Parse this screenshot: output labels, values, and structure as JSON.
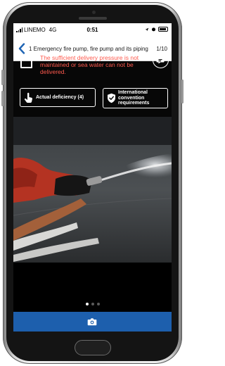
{
  "status_bar": {
    "carrier": "LINEMO",
    "network": "4G",
    "time": "0:51"
  },
  "nav": {
    "title": "1 Emergency fire pump, fire pump and its piping",
    "counter": "1/10"
  },
  "item": {
    "warning_text": "The sufficient delivery pressure is not maintained or sea water can not be delivered.",
    "checked": false
  },
  "buttons": {
    "actual_deficiency": "Actual deficiency (4)",
    "international_convention": "International convention requirements"
  },
  "pager": {
    "total": 3,
    "current": 1
  },
  "colors": {
    "accent_blue": "#1e64b4",
    "camera_bar": "#1d5fad",
    "warning_red": "#ff5a4e"
  },
  "icons": {
    "back": "chevron-left-icon",
    "comment": "comment-icon",
    "hand": "hand-pointer-icon",
    "shield": "shield-check-icon",
    "camera": "camera-icon"
  }
}
